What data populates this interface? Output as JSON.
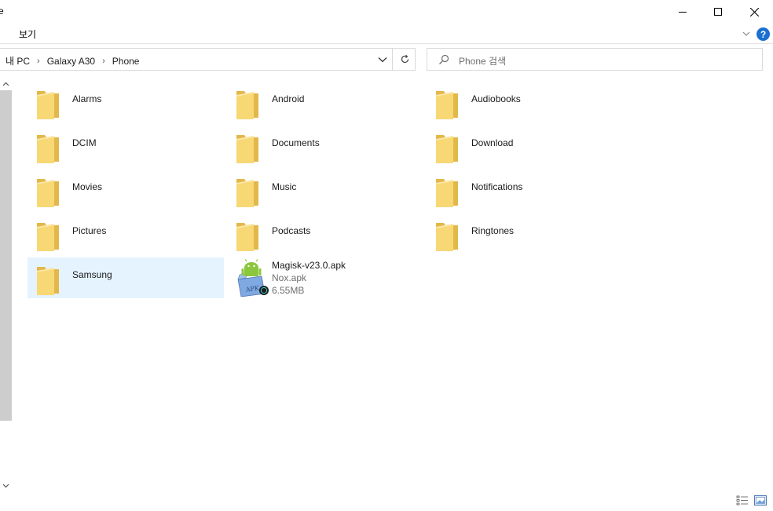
{
  "window": {
    "title_fragment": "e"
  },
  "ribbon": {
    "view_tab": "보기"
  },
  "address": {
    "crumbs": [
      "내 PC",
      "Galaxy A30",
      "Phone"
    ],
    "separator": "›"
  },
  "search": {
    "placeholder": "Phone 검색"
  },
  "items": [
    {
      "name": "Alarms",
      "type": "folder"
    },
    {
      "name": "Android",
      "type": "folder"
    },
    {
      "name": "Audiobooks",
      "type": "folder"
    },
    {
      "name": "DCIM",
      "type": "folder"
    },
    {
      "name": "Documents",
      "type": "folder"
    },
    {
      "name": "Download",
      "type": "folder"
    },
    {
      "name": "Movies",
      "type": "folder"
    },
    {
      "name": "Music",
      "type": "folder"
    },
    {
      "name": "Notifications",
      "type": "folder"
    },
    {
      "name": "Pictures",
      "type": "folder"
    },
    {
      "name": "Podcasts",
      "type": "folder"
    },
    {
      "name": "Ringtones",
      "type": "folder"
    },
    {
      "name": "Samsung",
      "type": "folder",
      "selected": true
    }
  ],
  "apk_file": {
    "name": "Magisk-v23.0.apk",
    "type_label": "Nox.apk",
    "size": "6.55MB"
  },
  "icons": {
    "folder": "folder-icon",
    "apk": "apk-file-icon",
    "search": "search-icon",
    "refresh": "refresh-icon",
    "help": "help-icon"
  },
  "colors": {
    "selection": "#e5f3ff",
    "folder": "#f8d775",
    "help_blue": "#1a6fd1"
  }
}
